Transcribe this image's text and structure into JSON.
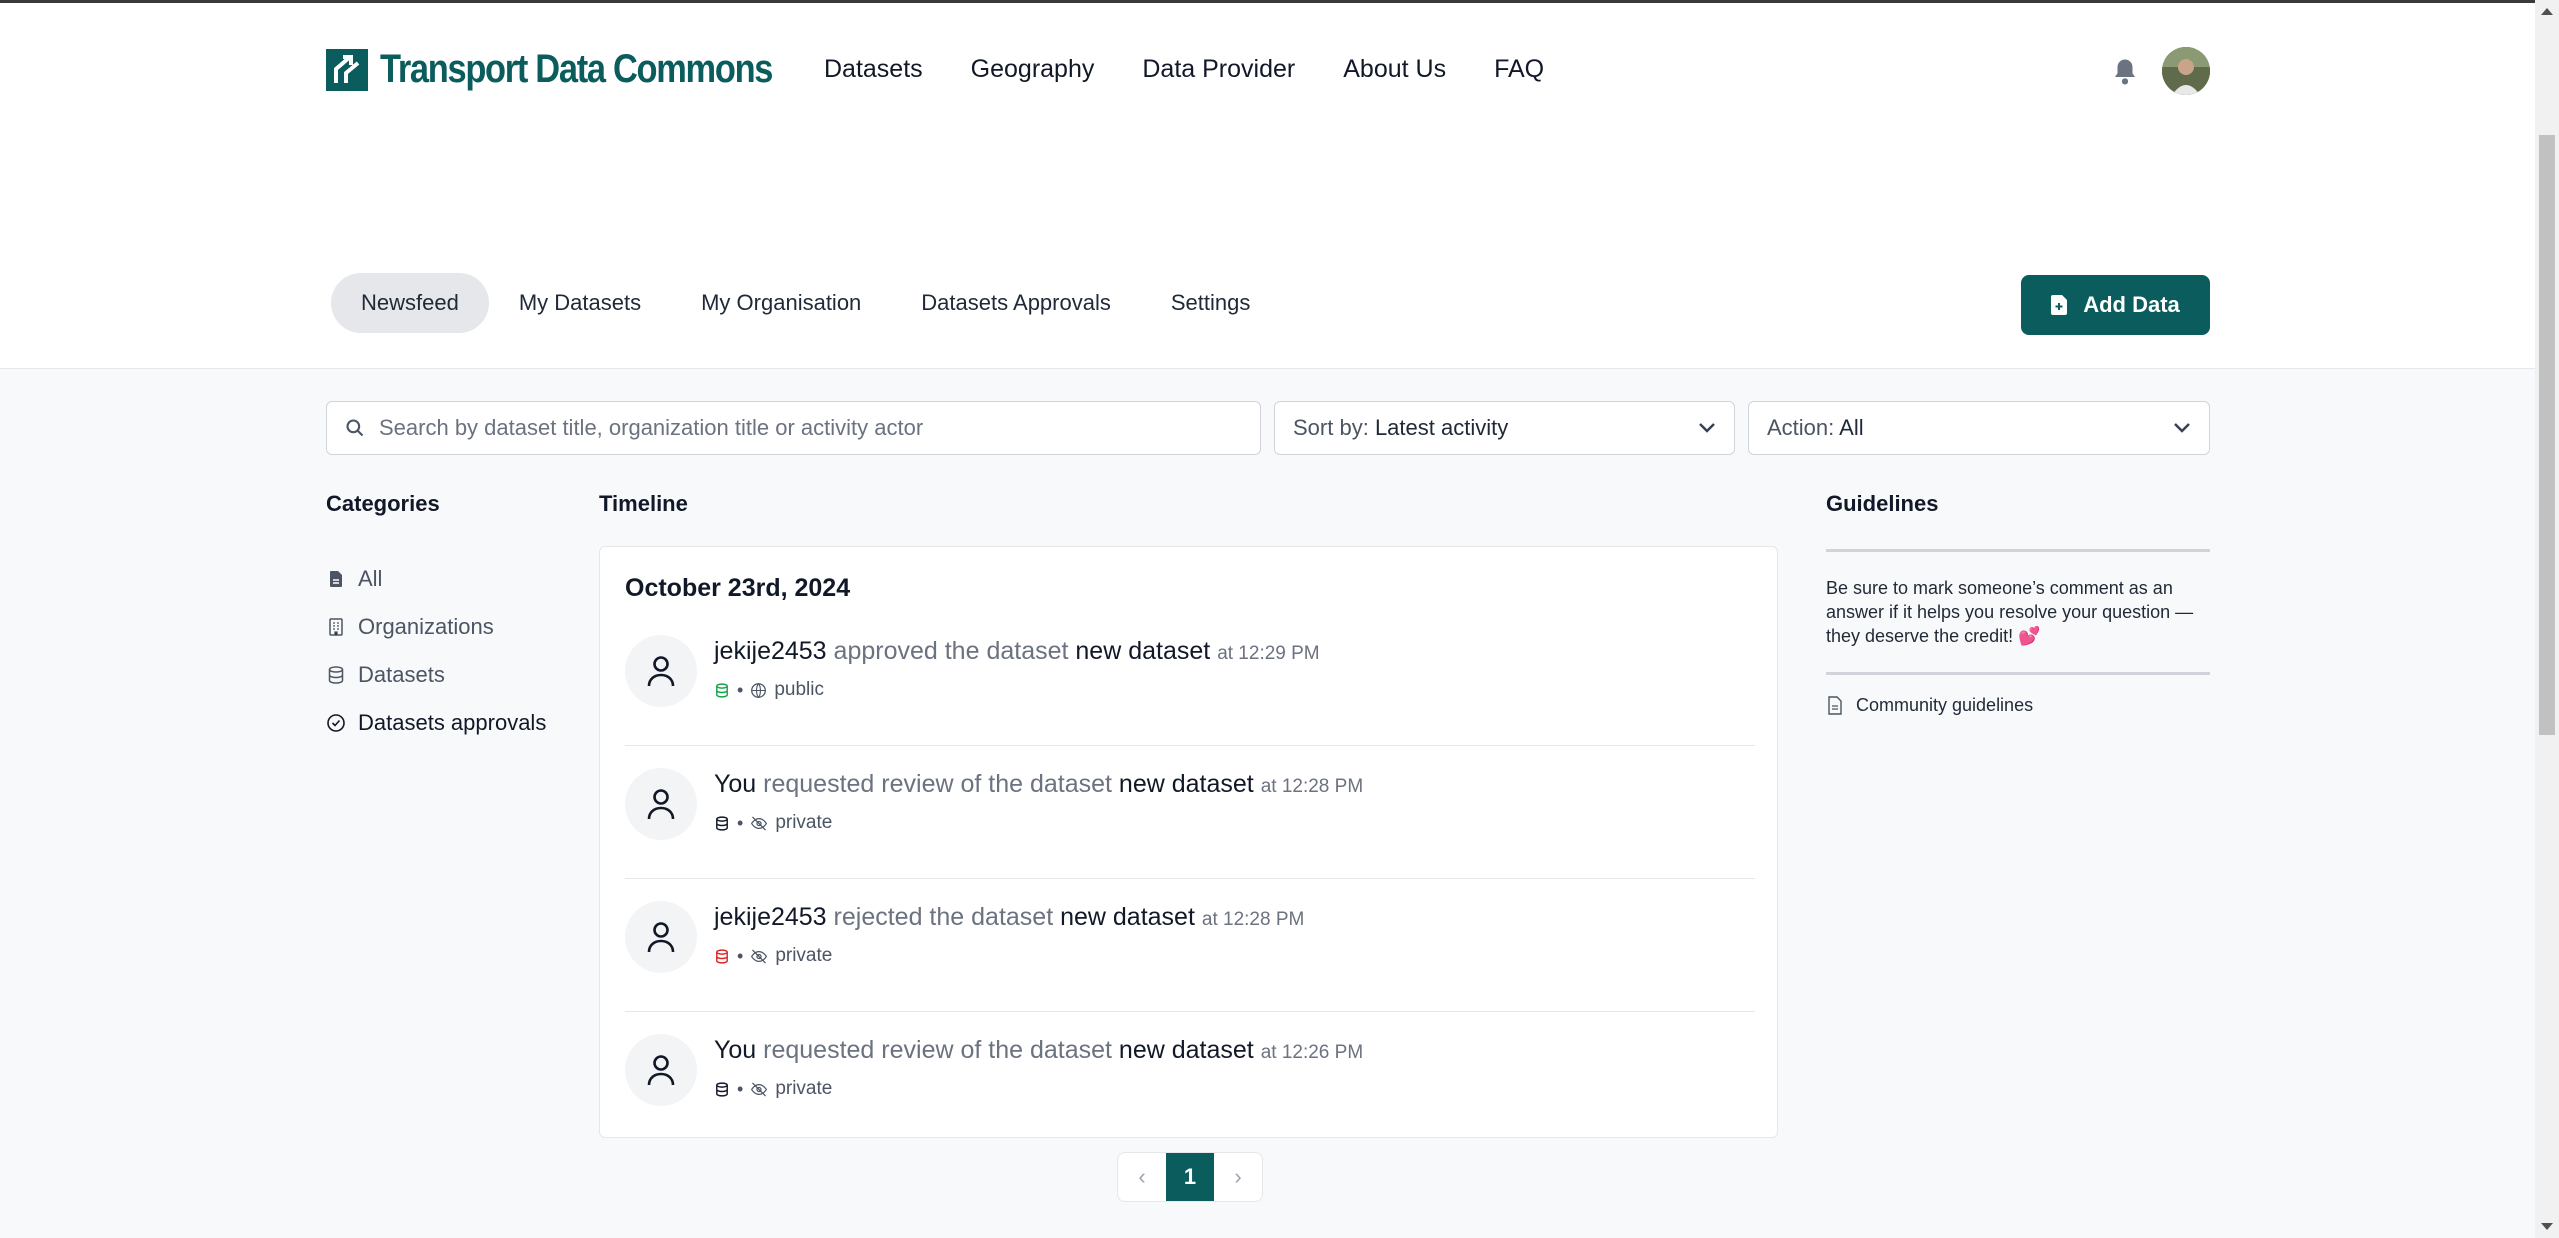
{
  "header": {
    "logo_text": "Transport Data Commons",
    "nav": [
      "Datasets",
      "Geography",
      "Data Provider",
      "About Us",
      "FAQ"
    ]
  },
  "tabs": [
    "Newsfeed",
    "My Datasets",
    "My Organisation",
    "Datasets Approvals",
    "Settings"
  ],
  "active_tab": "Newsfeed",
  "add_button": "Add Data",
  "search": {
    "placeholder": "Search by dataset title, organization title or activity actor"
  },
  "sort": {
    "label": "Sort by:",
    "value": "Latest activity"
  },
  "action_filter": {
    "label": "Action:",
    "value": "All"
  },
  "categories": {
    "title": "Categories",
    "items": [
      {
        "label": "All",
        "icon": "file-icon"
      },
      {
        "label": "Organizations",
        "icon": "building-icon"
      },
      {
        "label": "Datasets",
        "icon": "database-icon"
      },
      {
        "label": "Datasets approvals",
        "icon": "check-circle-icon"
      }
    ]
  },
  "timeline": {
    "title": "Timeline",
    "date": "October 23rd, 2024",
    "entries": [
      {
        "actor": "jekije2453",
        "verb": "approved the dataset",
        "object": "new dataset",
        "time": "at 12:29 PM",
        "visibility": "public",
        "db_color": "#16a34a"
      },
      {
        "actor": "You",
        "verb": "requested review of the dataset",
        "object": "new dataset",
        "time": "at 12:28 PM",
        "visibility": "private",
        "db_color": "#111827"
      },
      {
        "actor": "jekije2453",
        "verb": "rejected the dataset",
        "object": "new dataset",
        "time": "at 12:28 PM",
        "visibility": "private",
        "db_color": "#dc2626"
      },
      {
        "actor": "You",
        "verb": "requested review of the dataset",
        "object": "new dataset",
        "time": "at 12:26 PM",
        "visibility": "private",
        "db_color": "#111827"
      }
    ],
    "separator": "•"
  },
  "pagination": {
    "current": "1",
    "prev": "‹",
    "next": "›"
  },
  "guidelines": {
    "title": "Guidelines",
    "text": "Be sure to mark someone’s comment as an answer if it helps you resolve your question — they deserve the credit! 💕",
    "link": "Community guidelines"
  },
  "colors": {
    "brand": "#0b5c5c",
    "background": "#f8f9fa"
  }
}
